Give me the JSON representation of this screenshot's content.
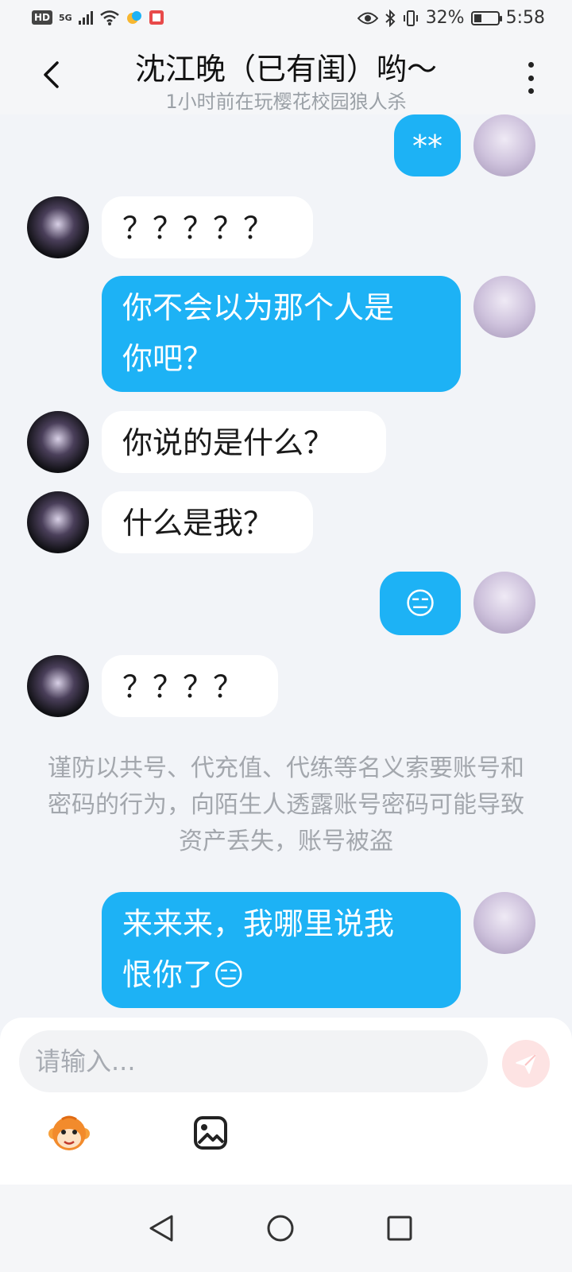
{
  "status_bar": {
    "hd_label": "HD",
    "network": "5G",
    "battery_percent": "32%",
    "battery_level": 0.32,
    "time": "5:58"
  },
  "header": {
    "title": "沈江晚（已有闺）哟～",
    "subtitle": "1小时前在玩樱花校园狼人杀"
  },
  "messages": [
    {
      "from": "me",
      "text": "**"
    },
    {
      "from": "them",
      "text": "？？？？？"
    },
    {
      "from": "me",
      "text": "你不会以为那个人是\n你吧？"
    },
    {
      "from": "them",
      "text": "你说的是什么？"
    },
    {
      "from": "them",
      "text": "什么是我？"
    },
    {
      "from": "me",
      "text": "😑"
    },
    {
      "from": "them",
      "text": "？？？？"
    },
    {
      "from": "me",
      "text": "来来来，我哪里说我\n恨你了😑"
    }
  ],
  "notice": "谨防以共号、代充值、代练等名义索要账号和密码的行为，向陌生人透露账号密码可能导致资产丢失，账号被盗",
  "input": {
    "placeholder": "请输入..."
  },
  "icons": {
    "back": "back-arrow-icon",
    "more": "more-vertical-icon",
    "send": "send-icon",
    "sticker": "monkey-sticker-icon",
    "image": "image-icon"
  },
  "colors": {
    "my_bubble": "#1db2f5",
    "their_bubble": "#ffffff",
    "background": "#f2f4f8"
  }
}
